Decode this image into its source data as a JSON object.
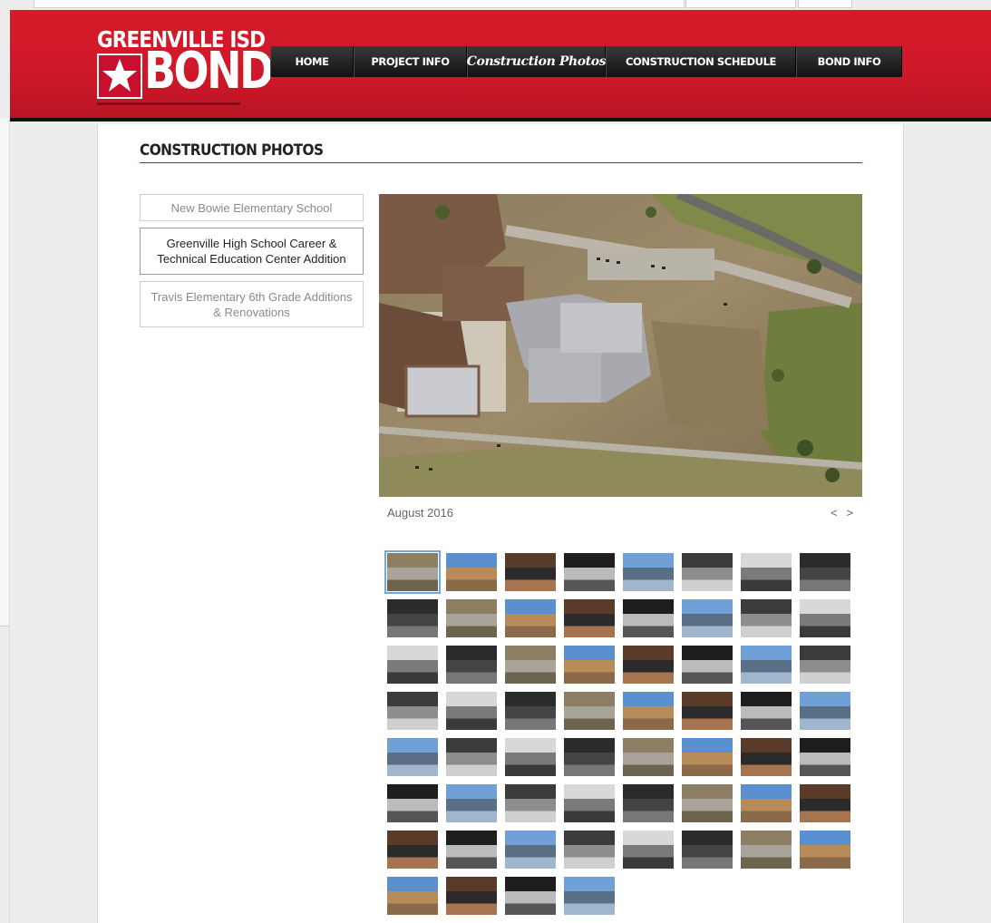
{
  "logo": {
    "line1": "GREENVILLE ISD",
    "line2": "BOND"
  },
  "nav": [
    {
      "label": "HOME"
    },
    {
      "label": "PROJECT INFO"
    },
    {
      "label": "Construction Photos"
    },
    {
      "label": "CONSTRUCTION SCHEDULE"
    },
    {
      "label": "BOND INFO"
    }
  ],
  "page": {
    "title": "CONSTRUCTION PHOTOS"
  },
  "projects": [
    {
      "label": "New Bowie Elementary School"
    },
    {
      "label": "Greenville High School Career & Technical Education Center Addition"
    },
    {
      "label": "Travis Elementary 6th Grade Additions & Renovations"
    }
  ],
  "viewer": {
    "caption": "August 2016",
    "prev_label": "<",
    "next_label": ">"
  },
  "colors": {
    "brand_red": "#d51a28",
    "nav_dark": "#111111",
    "rule_red": "#c8102e",
    "selection_blue": "#6fa8dc"
  }
}
